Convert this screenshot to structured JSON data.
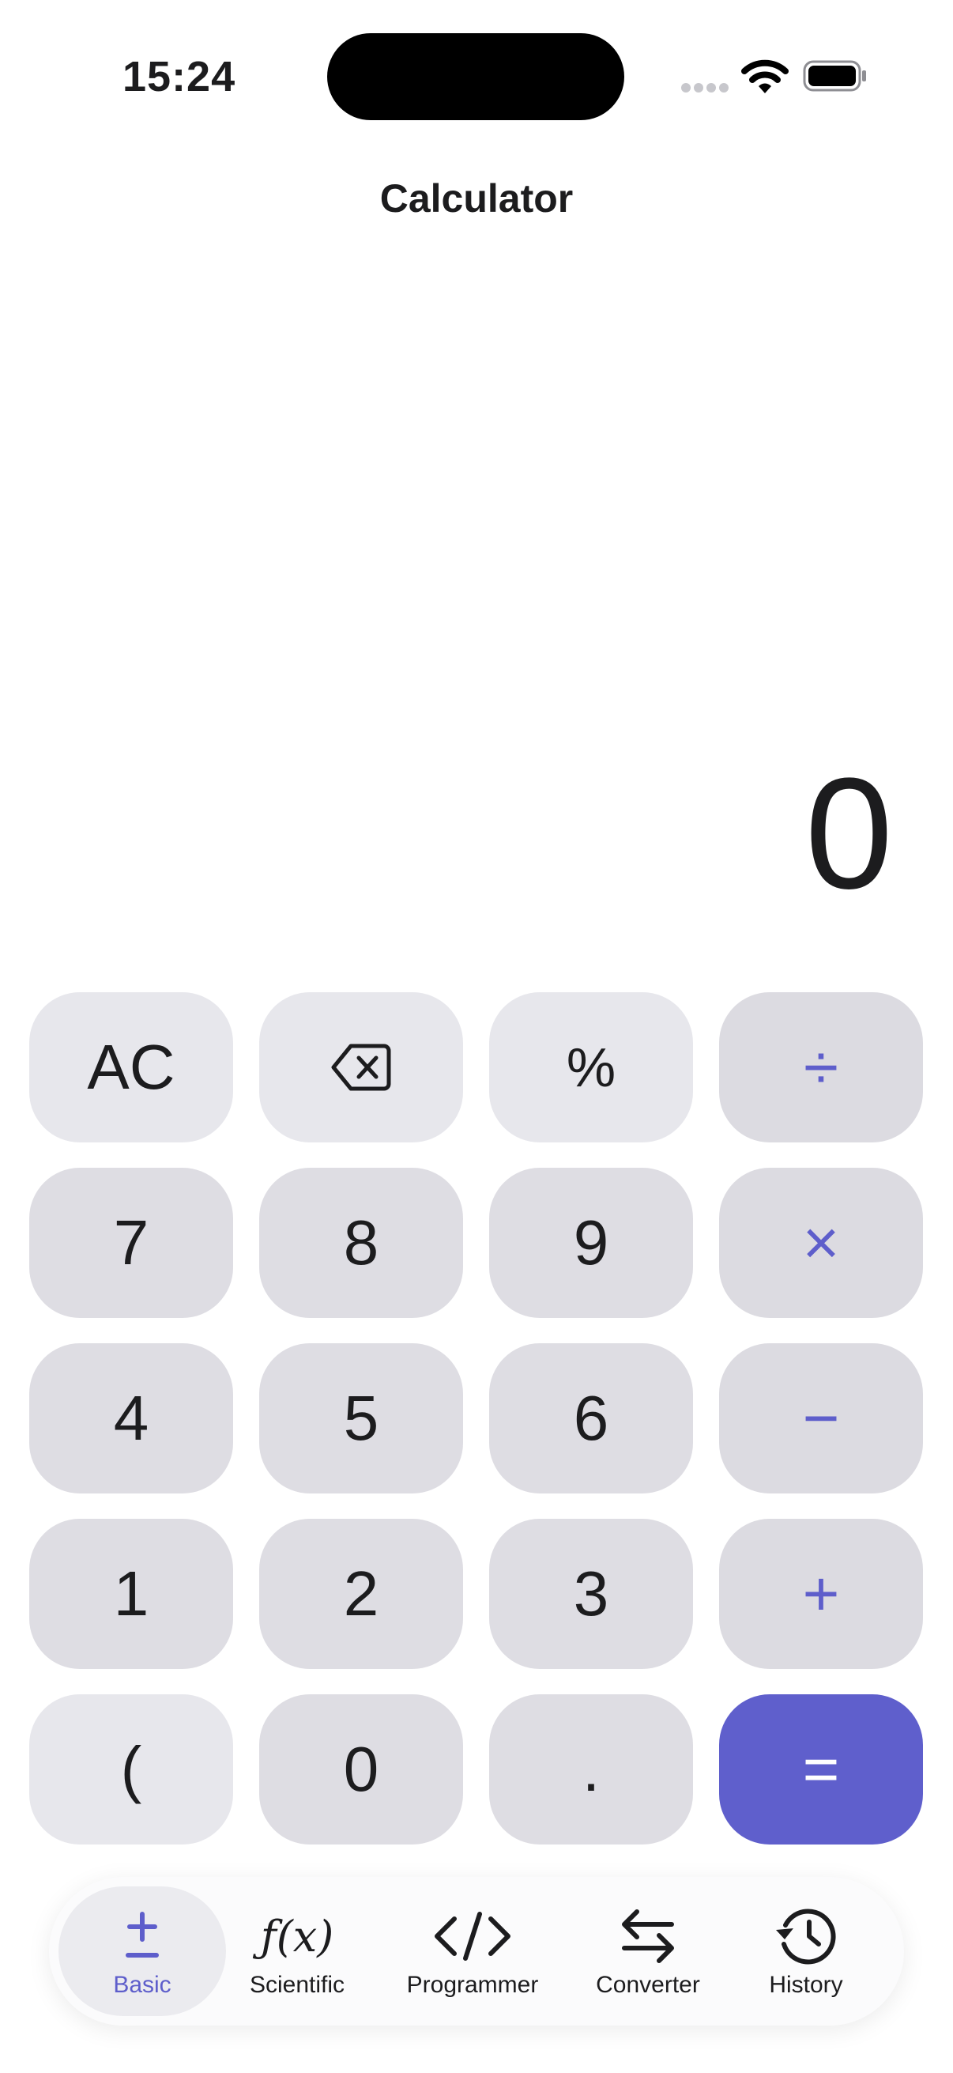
{
  "status_bar": {
    "time": "15:24"
  },
  "header": {
    "title": "Calculator"
  },
  "display": {
    "value": "0"
  },
  "keys": {
    "ac": "AC",
    "percent": "%",
    "divide": "÷",
    "seven": "7",
    "eight": "8",
    "nine": "9",
    "multiply": "×",
    "four": "4",
    "five": "5",
    "six": "6",
    "minus": "−",
    "one": "1",
    "two": "2",
    "three": "3",
    "plus": "+",
    "paren": "(",
    "zero": "0",
    "decimal": ".",
    "equals": "="
  },
  "tabs": [
    {
      "label": "Basic",
      "icon": "plus-minus-icon",
      "active": true
    },
    {
      "label": "Scientific",
      "icon": "function-icon",
      "icon_text": "ƒ(x)"
    },
    {
      "label": "Programmer",
      "icon": "code-icon"
    },
    {
      "label": "Converter",
      "icon": "arrows-swap-icon"
    },
    {
      "label": "History",
      "icon": "history-icon"
    }
  ],
  "colors": {
    "accent": "#5f5fcc",
    "key_light": "#e7e7ec",
    "key_num": "#dedde3"
  }
}
